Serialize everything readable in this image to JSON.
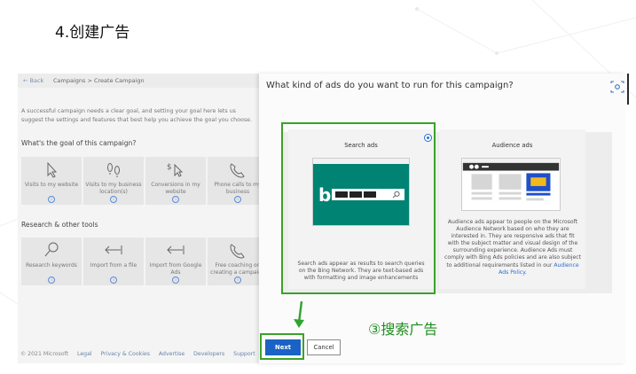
{
  "slide_title": "4.创建广告",
  "breadcrumb": {
    "back": "Back",
    "path": "Campaigns > Create Campaign"
  },
  "intro": "A successful campaign needs a clear goal, and setting your goal here lets us suggest the settings and features that best help you achieve the goal you choose.",
  "goal_heading": "What's the goal of this campaign?",
  "goals": [
    {
      "label": "Visits to my website",
      "icon": "cursor-icon"
    },
    {
      "label": "Visits to my business location(s)",
      "icon": "footsteps-icon"
    },
    {
      "label": "Conversions in my website",
      "icon": "dollar-cursor-icon"
    },
    {
      "label": "Phone calls to my business",
      "icon": "phone-icon"
    }
  ],
  "tools_heading": "Research & other tools",
  "tools": [
    {
      "label": "Research keywords",
      "icon": "magnifier-icon"
    },
    {
      "label": "Import from a file",
      "icon": "import-arrow-icon"
    },
    {
      "label": "Import from Google Ads",
      "icon": "import-arrow-icon"
    },
    {
      "label": "Free coaching on creating a campaign",
      "icon": "phone-icon"
    }
  ],
  "info_glyph": "i",
  "footer": {
    "copyright": "© 2021 Microsoft",
    "links": [
      "Legal",
      "Privacy & Cookies",
      "Advertise",
      "Developers",
      "Support"
    ]
  },
  "question": "What kind of ads do you want to run for this campaign?",
  "ad_types": {
    "search": {
      "title": "Search ads",
      "selected": true,
      "description": "Search ads appear as results to search queries on the Bing Network. They are text-based ads with formatting and image enhancements"
    },
    "audience": {
      "title": "Audience ads",
      "selected": false,
      "description": "Audience ads appear to people on the Microsoft Audience Network based on who they are interested in. They are responsive ads that fit with the subject matter and visual design of the surrounding experience. Audience Ads must comply with Bing Ads policies and are also subject to additional requirements listed in our",
      "link": "Audience Ads Policy."
    }
  },
  "annotation": "③搜索广告",
  "buttons": {
    "next": "Next",
    "cancel": "Cancel"
  },
  "colors": {
    "accent_blue": "#1a62c6",
    "highlight_green": "#3ba22a",
    "bing_teal": "#008373",
    "annotation_green": "#1d8e1d"
  }
}
